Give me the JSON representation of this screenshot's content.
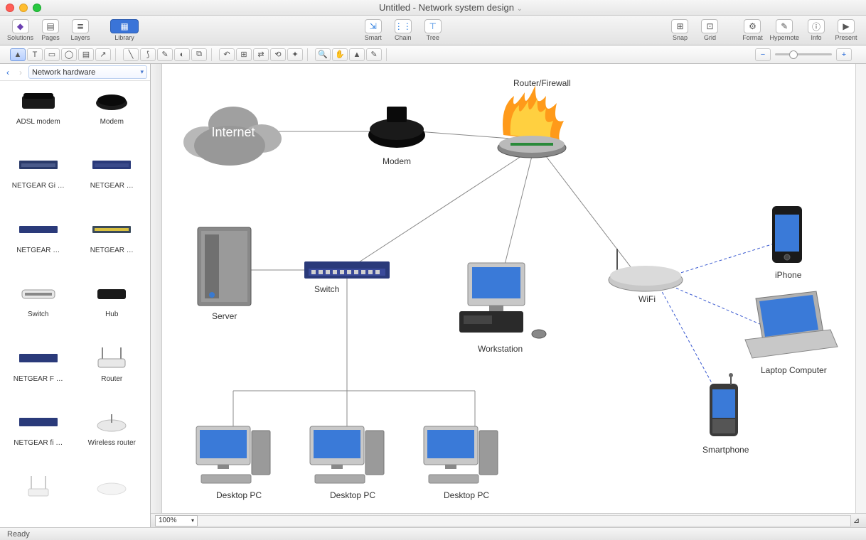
{
  "window": {
    "title": "Untitled - Network system design"
  },
  "toolbar": {
    "solutions": "Solutions",
    "pages": "Pages",
    "layers": "Layers",
    "library": "Library",
    "smart": "Smart",
    "chain": "Chain",
    "tree": "Tree",
    "snap": "Snap",
    "grid": "Grid",
    "format": "Format",
    "hypernote": "Hypernote",
    "info": "Info",
    "present": "Present"
  },
  "library": {
    "category": "Network hardware",
    "items": [
      {
        "label": "ADSL modem"
      },
      {
        "label": "Modem"
      },
      {
        "label": "NETGEAR Gi …"
      },
      {
        "label": "NETGEAR …"
      },
      {
        "label": "NETGEAR …"
      },
      {
        "label": "NETGEAR …"
      },
      {
        "label": "Switch"
      },
      {
        "label": "Hub"
      },
      {
        "label": "NETGEAR F …"
      },
      {
        "label": "Router"
      },
      {
        "label": "NETGEAR fi …"
      },
      {
        "label": "Wireless router"
      }
    ]
  },
  "diagram": {
    "internet": "Internet",
    "modem": "Modem",
    "firewall": "Router/Firewall",
    "server": "Server",
    "switch": "Switch",
    "workstation": "Workstation",
    "wifi": "WiFi",
    "iphone": "iPhone",
    "laptop": "Laptop Computer",
    "smartphone": "Smartphone",
    "desktop1": "Desktop PC",
    "desktop2": "Desktop PC",
    "desktop3": "Desktop PC"
  },
  "canvas": {
    "zoom": "100%"
  },
  "status": {
    "text": "Ready"
  }
}
